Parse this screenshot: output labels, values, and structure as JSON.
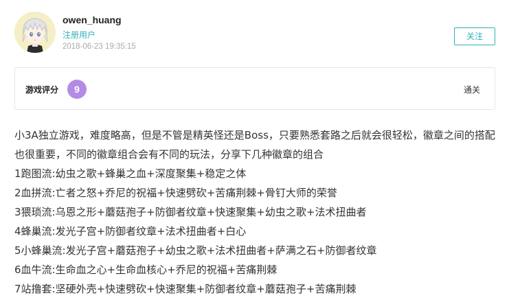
{
  "user": {
    "name": "owen_huang",
    "role": "注册用户",
    "timestamp": "2018-06-23 19:35:15",
    "follow_label": "关注"
  },
  "rating": {
    "label": "游戏评分",
    "score": "9",
    "status": "通关"
  },
  "review": {
    "intro": "小3A独立游戏，难度略高，但是不管是精英怪还是Boss，只要熟悉套路之后就会很轻松，徽章之间的搭配也很重要，不同的徽章组合会有不同的玩法，分享下几种徽章的组合",
    "lines": [
      "1跑图流:幼虫之歌+蜂巢之血+深度聚集+稳定之体",
      "2血拼流:亡者之怒+乔尼的祝福+快速劈砍+苦痛荆棘+骨钉大师的荣誉",
      "3猥琐流:乌恩之形+蘑菇孢子+防御者纹章+快速聚集+幼虫之歌+法术扭曲者",
      "4蜂巢流:发光子宫+防御者纹章+法术扭曲者+白心",
      "5小蜂巢流:发光子宫+蘑菇孢子+幼虫之歌+法术扭曲者+萨满之石+防御者纹章",
      "6血牛流:生命血之心+生命血核心+乔尼的祝福+苦痛荆棘",
      "7站撸套:坚硬外壳+快速劈砍+快速聚集+防御者纹章+蘑菇孢子+苦痛荆棘"
    ]
  },
  "colors": {
    "accent": "#2fb1b8",
    "score_badge": "#b48be3",
    "timestamp": "#aaaaaa"
  },
  "icons": {
    "avatar": "anime-character-avatar"
  }
}
